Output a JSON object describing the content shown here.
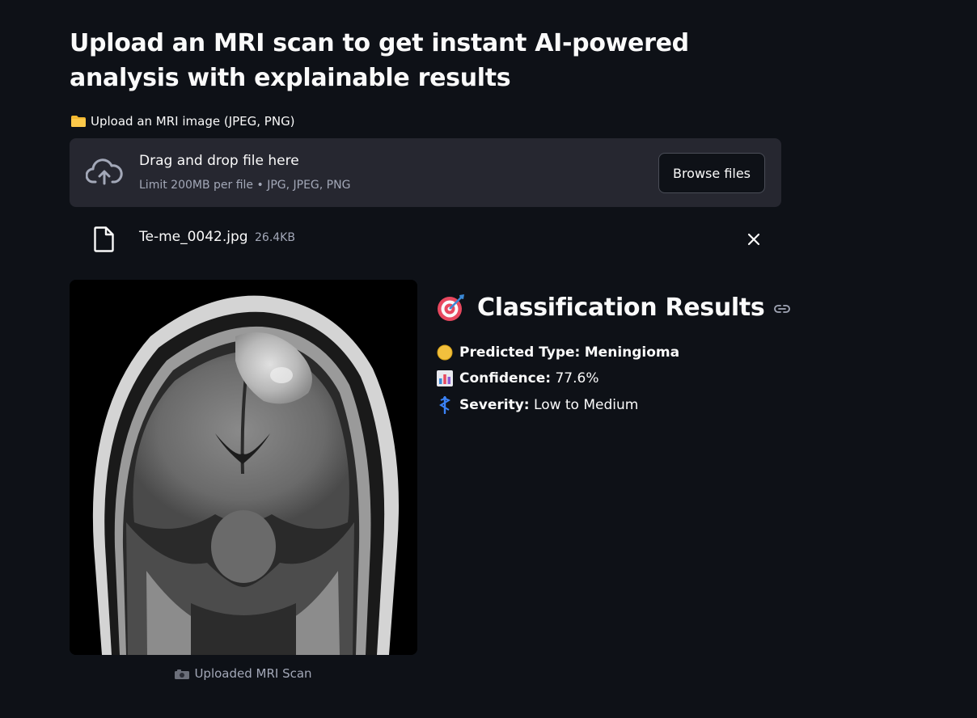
{
  "headline": "Upload an MRI scan to get instant AI-powered analysis with explainable results",
  "uploader": {
    "label": "Upload an MRI image (JPEG, PNG)",
    "label_icon": "folder-icon",
    "drop_title": "Drag and drop file here",
    "drop_subtitle": "Limit 200MB per file • JPG, JPEG, PNG",
    "browse_label": "Browse files"
  },
  "uploaded_file": {
    "name": "Te-me_0042.jpg",
    "size": "26.4KB"
  },
  "image": {
    "caption": "Uploaded MRI Scan",
    "caption_icon": "camera-icon"
  },
  "results": {
    "title_icon": "bullseye-icon",
    "title": "Classification Results",
    "predicted_label": "Predicted Type:",
    "predicted_value": "Meningioma",
    "predicted_icon": "yellow-circle-icon",
    "confidence_label": "Confidence:",
    "confidence_value": "77.6%",
    "confidence_icon": "bar-chart-icon",
    "severity_label": "Severity:",
    "severity_value": "Low to Medium",
    "severity_icon": "medical-symbol-icon"
  },
  "colors": {
    "background": "#0e1117",
    "panel": "#262730",
    "text": "#fafafa",
    "muted": "#a3a8b8",
    "yellow": "#f2c03d",
    "severity_blue": "#3b82f6"
  }
}
